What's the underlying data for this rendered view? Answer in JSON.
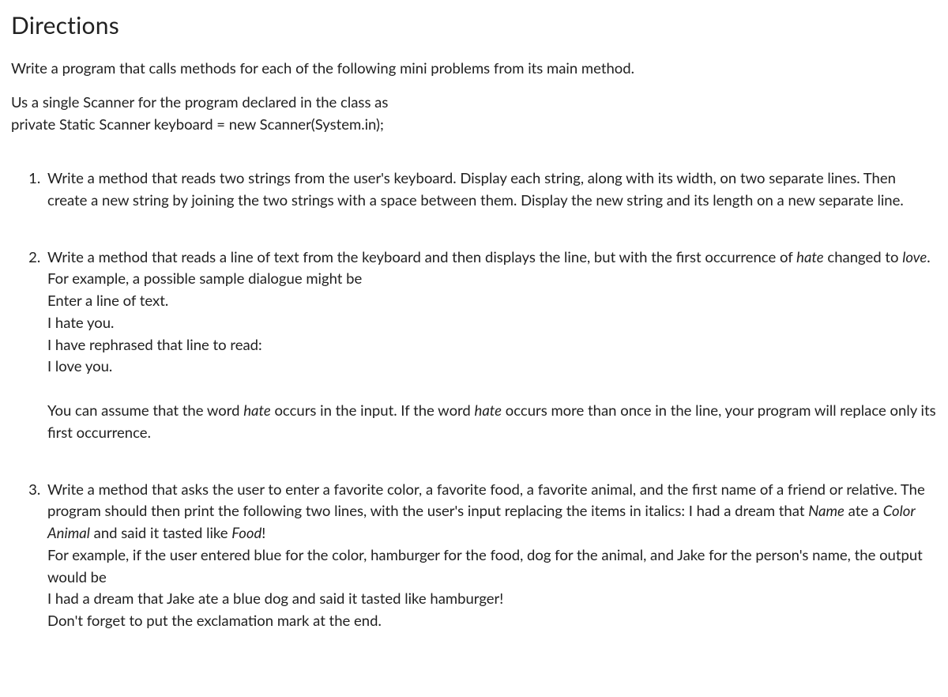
{
  "heading": "Directions",
  "intro": "Write a program that calls methods for each of the following mini problems from its main method.",
  "scanner_line1": "Us a single Scanner for the program declared in the class as",
  "scanner_line2": "private Static Scanner keyboard = new Scanner(System.in);",
  "problems": {
    "p1": {
      "text": "Write a method that reads two strings from the user's keyboard. Display each string, along with its width, on two separate lines. Then create a new string by joining the two strings with a space between them. Display the new string and its length on a new separate line."
    },
    "p2": {
      "seg1": "Write a method that reads a line of text from the keyboard and then displays the line, but with the first occurrence of ",
      "hate1": "hate",
      "seg2": " changed to ",
      "love": "love",
      "seg3": ". For example, a possible sample dialogue might be",
      "l1": "Enter a line of text.",
      "l2": "I hate you.",
      "l3": "I have rephrased that line to read:",
      "l4": "I love you.",
      "note_a": "You can assume that the word ",
      "hate2": "hate",
      "note_b": " occurs in the input. If the word ",
      "hate3": "hate",
      "note_c": " occurs more than once in the line, your program will replace only its first occurrence."
    },
    "p3": {
      "seg1": "Write a method that asks the user to enter a favorite color, a favorite food, a favorite animal, and the first name of a friend or relative. The program should then print the following two lines, with the user's input replacing the items in italics: I had a dream that ",
      "name": "Name",
      "seg2": " ate a ",
      "coloranimal": "Color Animal",
      "seg3": " and said it tasted like ",
      "food": "Food",
      "seg4": "!",
      "example": "For example, if the user entered blue for the color, hamburger for the food, dog for the animal, and Jake for the person's name, the output would be",
      "out1": "I had a dream that Jake ate a blue dog and said it tasted like hamburger!",
      "out2": "Don't forget to put the exclamation mark at the end."
    }
  }
}
